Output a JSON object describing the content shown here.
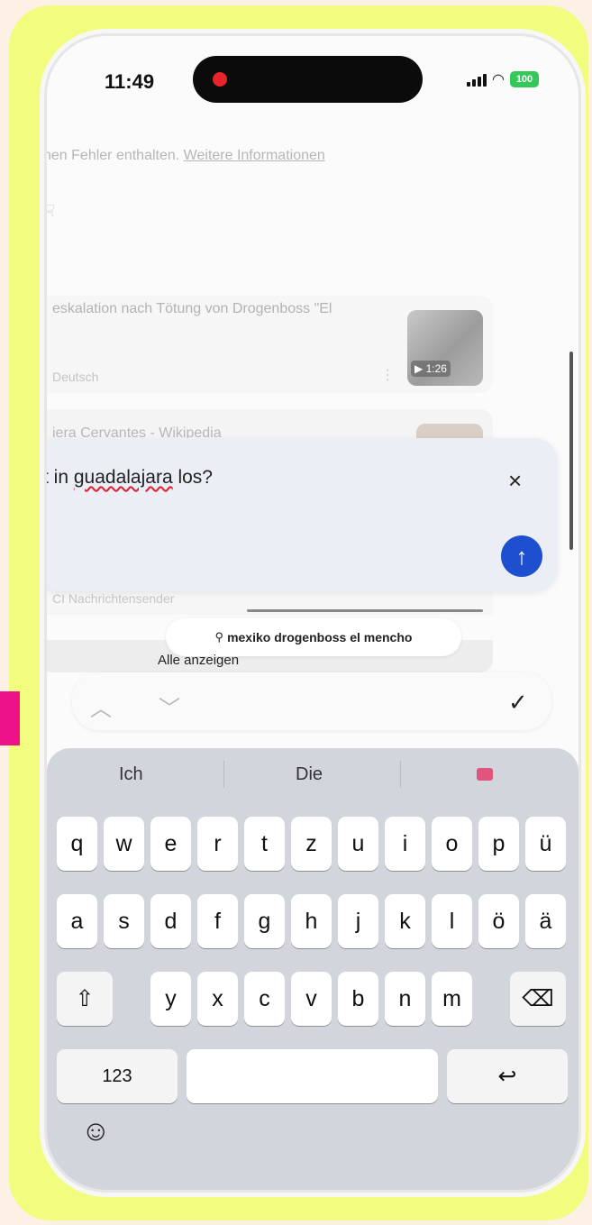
{
  "status": {
    "time": "11:49",
    "battery": "100"
  },
  "background": {
    "error_text": "nen Fehler enthalten.",
    "error_link": "Weitere Informationen"
  },
  "results": [
    {
      "title": "eskalation nach Tötung von Drogenboss \"El",
      "source": "Deutsch",
      "duration": "1:26"
    },
    {
      "title": "iera Cervantes - Wikipedia"
    },
    {
      "source": "CI Nachrichtensender"
    }
  ],
  "compose": {
    "text_before": "t in ",
    "misspelled_word": "guadalajara",
    "text_after": " los?",
    "close_icon": "×",
    "send_icon": "↑"
  },
  "suggestion_chip": "mexiko drogenboss el mencho",
  "show_all": "Alle anzeigen",
  "accessory_bar": {
    "up": "︿",
    "down": "﹀",
    "done": "✓"
  },
  "keyboard": {
    "suggestions": [
      "Ich",
      "Die"
    ],
    "row1": [
      "q",
      "w",
      "e",
      "r",
      "t",
      "z",
      "u",
      "i",
      "o",
      "p",
      "ü"
    ],
    "row2": [
      "a",
      "s",
      "d",
      "f",
      "g",
      "h",
      "j",
      "k",
      "l",
      "ö",
      "ä"
    ],
    "row3": [
      "y",
      "x",
      "c",
      "v",
      "b",
      "n",
      "m"
    ],
    "shift_icon": "⇧",
    "backspace_icon": "⌫",
    "numbers_label": "123",
    "return_icon": "↩",
    "emoji_icon": "☺"
  },
  "colors": {
    "frame": "#f2fc7e",
    "accent_pink": "#ee1289",
    "send_button": "#1d4fce"
  }
}
